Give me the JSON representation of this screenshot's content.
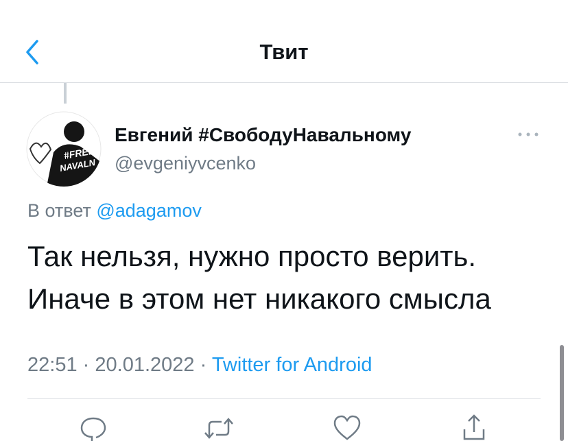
{
  "header": {
    "title": "Твит",
    "back_icon": "chevron-left-icon"
  },
  "tweet": {
    "author": {
      "display_name": "Евгений #СвободуНавальному",
      "handle": "@evgeniyvcenko",
      "avatar_text": [
        "#FREE",
        "NAVALN"
      ]
    },
    "reply_prefix": "В ответ",
    "reply_to": "@adagamov",
    "text_lines": [
      "Так нельзя, нужно просто верить.",
      "Иначе в этом нет никакого смысла"
    ],
    "time": "22:51",
    "date": "20.01.2022",
    "separator": "·",
    "source": "Twitter for Android"
  },
  "actions": [
    "reply-icon",
    "retweet-icon",
    "like-icon",
    "share-icon"
  ],
  "colors": {
    "accent": "#1d9bf0",
    "muted": "#6f7b86",
    "divider": "#d9dde1"
  }
}
